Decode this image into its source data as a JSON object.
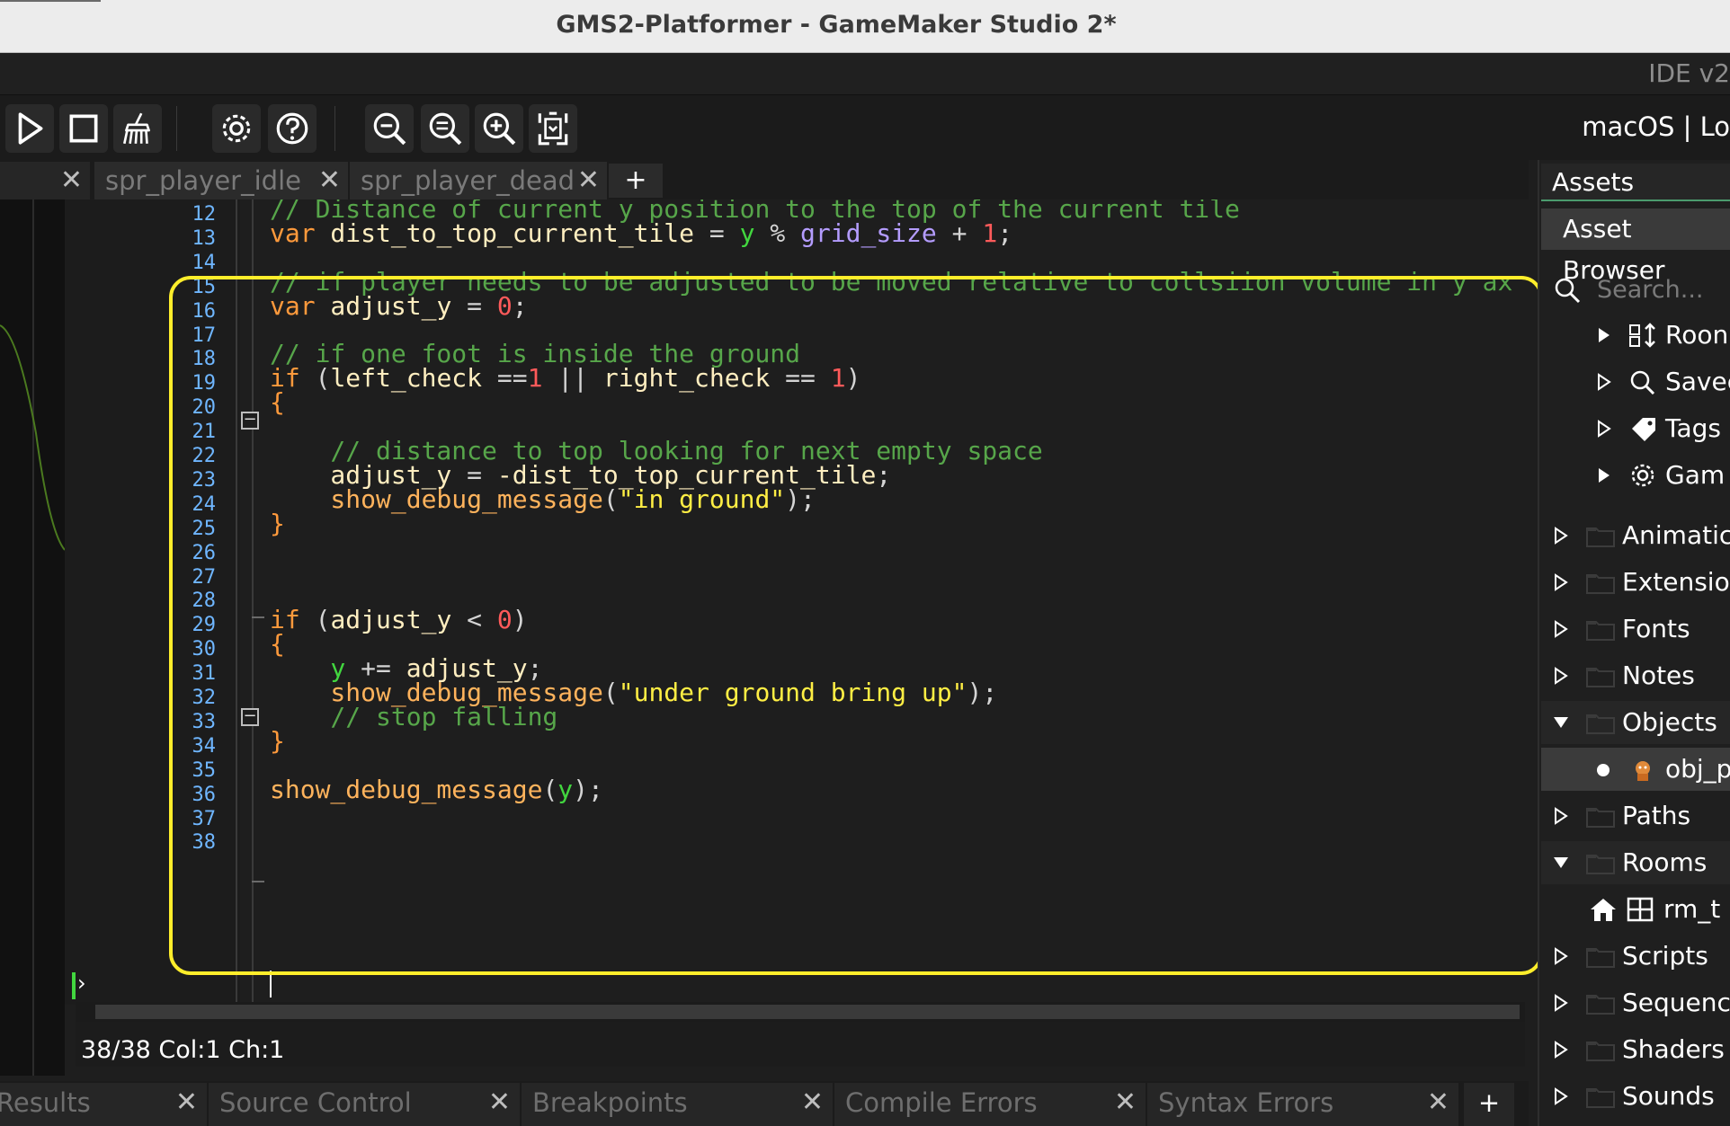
{
  "window": {
    "title": "GMS2-Platformer - GameMaker Studio 2*",
    "ide_label": "IDE v2",
    "target_label": "macOS | Lo"
  },
  "toolbar": {
    "buttons": [
      "play-icon",
      "stop-icon",
      "clean-icon",
      "settings-icon",
      "help-icon",
      "zoom-out-icon",
      "zoom-reset-icon",
      "zoom-in-icon",
      "fit-icon"
    ]
  },
  "tabs": {
    "items": [
      {
        "label": "spr_player_idle"
      },
      {
        "label": "spr_player_dead"
      }
    ],
    "add_label": "+"
  },
  "editor": {
    "line_numbers": [
      "12",
      "13",
      "14",
      "15",
      "16",
      "17",
      "18",
      "19",
      "20",
      "21",
      "22",
      "23",
      "24",
      "25",
      "26",
      "27",
      "28",
      "29",
      "30",
      "31",
      "32",
      "33",
      "34",
      "35",
      "36",
      "37",
      "38"
    ],
    "lines": [
      [
        {
          "t": "// Distance of current y position to the top of the current tile",
          "c": "#57a64a"
        }
      ],
      [
        {
          "t": "var",
          "c": "#ff9a3c"
        },
        {
          "t": " dist_to_top_current_tile ",
          "c": "#ffeec0"
        },
        {
          "t": "=",
          "c": "#d4d4d4"
        },
        {
          "t": " y ",
          "c": "#42d63f"
        },
        {
          "t": "%",
          "c": "#d4d4d4"
        },
        {
          "t": " grid_size ",
          "c": "#b49cff"
        },
        {
          "t": "+",
          "c": "#d4d4d4"
        },
        {
          "t": " 1",
          "c": "#ff5a5a"
        },
        {
          "t": ";",
          "c": "#d4d4d4"
        }
      ],
      [],
      [
        {
          "t": "// if player needs to be adjusted to be moved relative to collsiion volume in y ax",
          "c": "#57a64a"
        }
      ],
      [
        {
          "t": "var",
          "c": "#ff9a3c"
        },
        {
          "t": " adjust_y ",
          "c": "#ffeec0"
        },
        {
          "t": "=",
          "c": "#d4d4d4"
        },
        {
          "t": " 0",
          "c": "#ff5a5a"
        },
        {
          "t": ";",
          "c": "#d4d4d4"
        }
      ],
      [],
      [
        {
          "t": "// if one foot is inside the ground",
          "c": "#57a64a"
        }
      ],
      [
        {
          "t": "if",
          "c": "#ff9a3c"
        },
        {
          "t": " (",
          "c": "#d4d4d4"
        },
        {
          "t": "left_check",
          "c": "#ffeec0"
        },
        {
          "t": " ==",
          "c": "#d4d4d4"
        },
        {
          "t": "1",
          "c": "#ff5a5a"
        },
        {
          "t": " || ",
          "c": "#d4d4d4"
        },
        {
          "t": "right_check",
          "c": "#ffeec0"
        },
        {
          "t": " == ",
          "c": "#d4d4d4"
        },
        {
          "t": "1",
          "c": "#ff5a5a"
        },
        {
          "t": ")",
          "c": "#d4d4d4"
        }
      ],
      [
        {
          "t": "{",
          "c": "#ff9a3c"
        }
      ],
      [],
      [
        {
          "t": "    // distance to top looking for next empty space",
          "c": "#57a64a"
        }
      ],
      [
        {
          "t": "    adjust_y ",
          "c": "#ffeec0"
        },
        {
          "t": "=",
          "c": "#d4d4d4"
        },
        {
          "t": " -dist_to_top_current_tile",
          "c": "#ffeec0"
        },
        {
          "t": ";",
          "c": "#d4d4d4"
        }
      ],
      [
        {
          "t": "    show_debug_message",
          "c": "#ffb35c"
        },
        {
          "t": "(",
          "c": "#d4d4d4"
        },
        {
          "t": "\"in ground\"",
          "c": "#ffee44"
        },
        {
          "t": ");",
          "c": "#d4d4d4"
        }
      ],
      [
        {
          "t": "}",
          "c": "#ff9a3c"
        }
      ],
      [],
      [],
      [],
      [
        {
          "t": "if",
          "c": "#ff9a3c"
        },
        {
          "t": " (",
          "c": "#d4d4d4"
        },
        {
          "t": "adjust_y",
          "c": "#ffeec0"
        },
        {
          "t": " < ",
          "c": "#d4d4d4"
        },
        {
          "t": "0",
          "c": "#ff5a5a"
        },
        {
          "t": ")",
          "c": "#d4d4d4"
        }
      ],
      [
        {
          "t": "{",
          "c": "#ff9a3c"
        }
      ],
      [
        {
          "t": "    y",
          "c": "#42d63f"
        },
        {
          "t": " += ",
          "c": "#d4d4d4"
        },
        {
          "t": "adjust_y",
          "c": "#ffeec0"
        },
        {
          "t": ";",
          "c": "#d4d4d4"
        }
      ],
      [
        {
          "t": "    show_debug_message",
          "c": "#ffb35c"
        },
        {
          "t": "(",
          "c": "#d4d4d4"
        },
        {
          "t": "\"under ground bring up\"",
          "c": "#ffee44"
        },
        {
          "t": ");",
          "c": "#d4d4d4"
        }
      ],
      [
        {
          "t": "    // stop falling",
          "c": "#57a64a"
        }
      ],
      [
        {
          "t": "}",
          "c": "#ff9a3c"
        }
      ],
      [],
      [
        {
          "t": "show_debug_message",
          "c": "#ffb35c"
        },
        {
          "t": "(",
          "c": "#d4d4d4"
        },
        {
          "t": "y",
          "c": "#42d63f"
        },
        {
          "t": ");",
          "c": "#d4d4d4"
        }
      ],
      [],
      []
    ],
    "status": "38/38 Col:1 Ch:1"
  },
  "bottom_tabs": [
    "Results",
    "Source Control",
    "Breakpoints",
    "Compile Errors",
    "Syntax Errors"
  ],
  "bottom_add_label": "+",
  "assets": {
    "title": "Assets",
    "browser_label": "Asset Browser",
    "search_placeholder": "Search...",
    "tree": [
      {
        "label": "Roon",
        "icon": "room-order-icon",
        "arrow": "filled"
      },
      {
        "label": "Savec",
        "icon": "search-icon",
        "arrow": "outline"
      },
      {
        "label": "Tags",
        "icon": "tag-icon",
        "arrow": "outline"
      },
      {
        "label": "Gam",
        "icon": "gear-icon",
        "arrow": "filled"
      },
      {
        "label": "Animatic",
        "icon": "folder-icon",
        "arrow": "outline"
      },
      {
        "label": "Extensio",
        "icon": "folder-icon",
        "arrow": "outline"
      },
      {
        "label": "Fonts",
        "icon": "folder-icon",
        "arrow": "outline"
      },
      {
        "label": "Notes",
        "icon": "folder-icon",
        "arrow": "outline"
      },
      {
        "label": "Objects",
        "icon": "folder-icon",
        "arrow": "down"
      },
      {
        "label": "obj_p",
        "icon": "player-object-icon",
        "arrow": "none"
      },
      {
        "label": "Paths",
        "icon": "folder-icon",
        "arrow": "outline"
      },
      {
        "label": "Rooms",
        "icon": "folder-icon",
        "arrow": "down"
      },
      {
        "label": "rm_t",
        "icon": "room-icon",
        "arrow": "none"
      },
      {
        "label": "Scripts",
        "icon": "folder-icon",
        "arrow": "outline"
      },
      {
        "label": "Sequenc",
        "icon": "folder-icon",
        "arrow": "outline"
      },
      {
        "label": "Shaders",
        "icon": "folder-icon",
        "arrow": "outline"
      },
      {
        "label": "Sounds",
        "icon": "folder-icon",
        "arrow": "outline"
      }
    ]
  },
  "colors": {
    "highlight_box": "#ffee2b",
    "line_numbers": "#6fb6ff",
    "comment": "#57a64a",
    "keyword": "#ff9a3c"
  }
}
